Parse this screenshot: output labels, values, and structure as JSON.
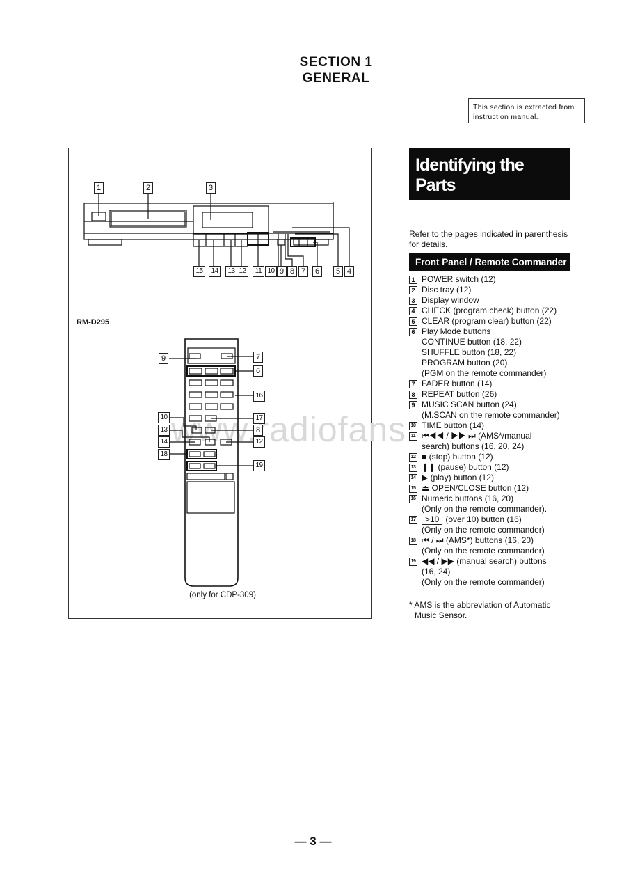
{
  "header": {
    "section": "SECTION 1",
    "title": "GENERAL",
    "note": "This section is extracted from instruction manual."
  },
  "figure": {
    "front_panel_callouts": [
      "1",
      "2",
      "3",
      "4",
      "5",
      "6",
      "7",
      "8",
      "9",
      "10",
      "11",
      "12",
      "13",
      "14",
      "15"
    ],
    "remote_model": "RM-D295",
    "remote_callouts": [
      "9",
      "7",
      "6",
      "16",
      "10",
      "17",
      "13",
      "8",
      "14",
      "12",
      "18",
      "19"
    ],
    "remote_caption": "(only for CDP-309)",
    "watermark": "www.radiofans"
  },
  "content": {
    "title_line1": "Identifying the",
    "title_line2": "Parts",
    "intro": "Refer to the pages indicated in parenthesis for details.",
    "subheading": "Front Panel / Remote Commander",
    "items": [
      {
        "num": "1",
        "lines": [
          "POWER switch (12)"
        ]
      },
      {
        "num": "2",
        "lines": [
          "Disc tray (12)"
        ]
      },
      {
        "num": "3",
        "lines": [
          "Display window"
        ]
      },
      {
        "num": "4",
        "lines": [
          "CHECK (program check) button (22)"
        ]
      },
      {
        "num": "5",
        "lines": [
          "CLEAR (program clear) button (22)"
        ]
      },
      {
        "num": "6",
        "lines": [
          "Play Mode buttons",
          "CONTINUE button (18, 22)",
          "SHUFFLE button (18, 22)",
          "PROGRAM button (20)",
          "(PGM on the remote commander)"
        ]
      },
      {
        "num": "7",
        "lines": [
          "FADER button (14)"
        ]
      },
      {
        "num": "8",
        "lines": [
          "REPEAT button (26)"
        ]
      },
      {
        "num": "9",
        "lines": [
          "MUSIC SCAN button (24)",
          "(M.SCAN on the remote commander)"
        ]
      },
      {
        "num": "10",
        "lines": [
          "TIME button (14)"
        ]
      },
      {
        "num": "11",
        "lines": [
          "⏮◀◀ / ▶▶ ⏭ (AMS*/manual",
          "search) buttons (16, 20, 24)"
        ]
      },
      {
        "num": "12",
        "lines": [
          "■ (stop) button (12)"
        ]
      },
      {
        "num": "13",
        "lines": [
          "❚❚ (pause) button (12)"
        ]
      },
      {
        "num": "14",
        "lines": [
          "▶ (play) button (12)"
        ]
      },
      {
        "num": "15",
        "lines": [
          "⏏ OPEN/CLOSE button (12)"
        ]
      },
      {
        "num": "16",
        "lines": [
          "Numeric buttons (16, 20)",
          "(Only on the remote commander)."
        ]
      },
      {
        "num": "17",
        "boxed": ">10",
        "lines": [
          "(over 10) button (16)",
          "(Only on the remote commander)"
        ]
      },
      {
        "num": "18",
        "lines": [
          "⏮ / ⏭ (AMS*) buttons  (16, 20)",
          "(Only on the remote commander)"
        ]
      },
      {
        "num": "19",
        "lines": [
          "◀◀ / ▶▶ (manual search) buttons",
          "(16, 24)",
          "(Only on the remote commander)"
        ]
      }
    ],
    "footnote_line1": "* AMS is the abbreviation of Automatic",
    "footnote_line2": "Music Sensor."
  },
  "footer": {
    "page_number": "— 3 —"
  }
}
